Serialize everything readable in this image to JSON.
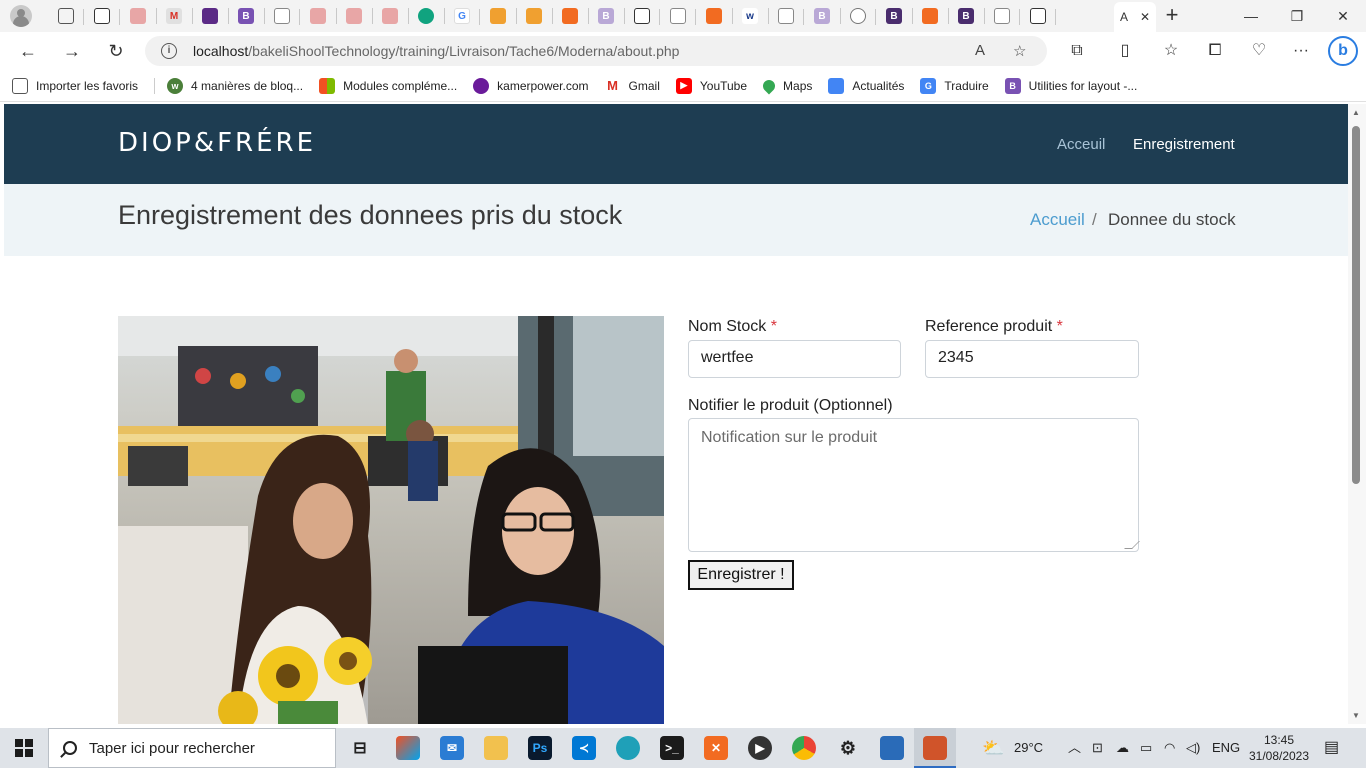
{
  "browser": {
    "active_tab_title": "A",
    "url_host": "localhost",
    "url_path": "/bakeliShoolTechnology/training/Livraison/Tache6/Moderna/about.php",
    "favorites": [
      {
        "label": "Importer les favoris",
        "icon": "import-icon",
        "color": "#555555"
      },
      {
        "label": "4 manières de bloq...",
        "icon": "wikihow-icon",
        "color": "#4b7f3a"
      },
      {
        "label": "Modules compléme...",
        "icon": "microsoft-icon",
        "color": "#f25022"
      },
      {
        "label": "kamerpower.com",
        "icon": "kamerpower-icon",
        "color": "#6a1b9a"
      },
      {
        "label": "Gmail",
        "icon": "gmail-icon",
        "color": "#d93025"
      },
      {
        "label": "YouTube",
        "icon": "youtube-icon",
        "color": "#ff0000"
      },
      {
        "label": "Maps",
        "icon": "maps-icon",
        "color": "#34a853"
      },
      {
        "label": "Actualités",
        "icon": "news-icon",
        "color": "#4285f4"
      },
      {
        "label": "Traduire",
        "icon": "translate-icon",
        "color": "#4285f4"
      },
      {
        "label": "Utilities for layout -...",
        "icon": "bootstrap-icon",
        "color": "#7952b3"
      }
    ]
  },
  "site": {
    "logo": "DIOP&FRÉRE",
    "nav": [
      {
        "label": "Acceuil"
      },
      {
        "label": "Enregistrement"
      }
    ],
    "page_title": "Enregistrement des donnees pris du stock",
    "breadcrumb": {
      "home": "Accueil",
      "separator": "/",
      "current": "Donnee du stock"
    }
  },
  "form": {
    "nom_stock": {
      "label": "Nom Stock",
      "required_mark": "*",
      "value": "wertfee"
    },
    "reference": {
      "label": "Reference produit",
      "required_mark": "*",
      "value": "2345"
    },
    "notifier": {
      "label": "Notifier le produit (Optionnel)",
      "placeholder": "Notification sur le produit"
    },
    "submit_label": "Enregistrer !"
  },
  "taskbar": {
    "search_placeholder": "Taper ici pour rechercher",
    "weather": "29°C",
    "language": "ENG",
    "time": "13:45",
    "date": "31/08/2023"
  }
}
